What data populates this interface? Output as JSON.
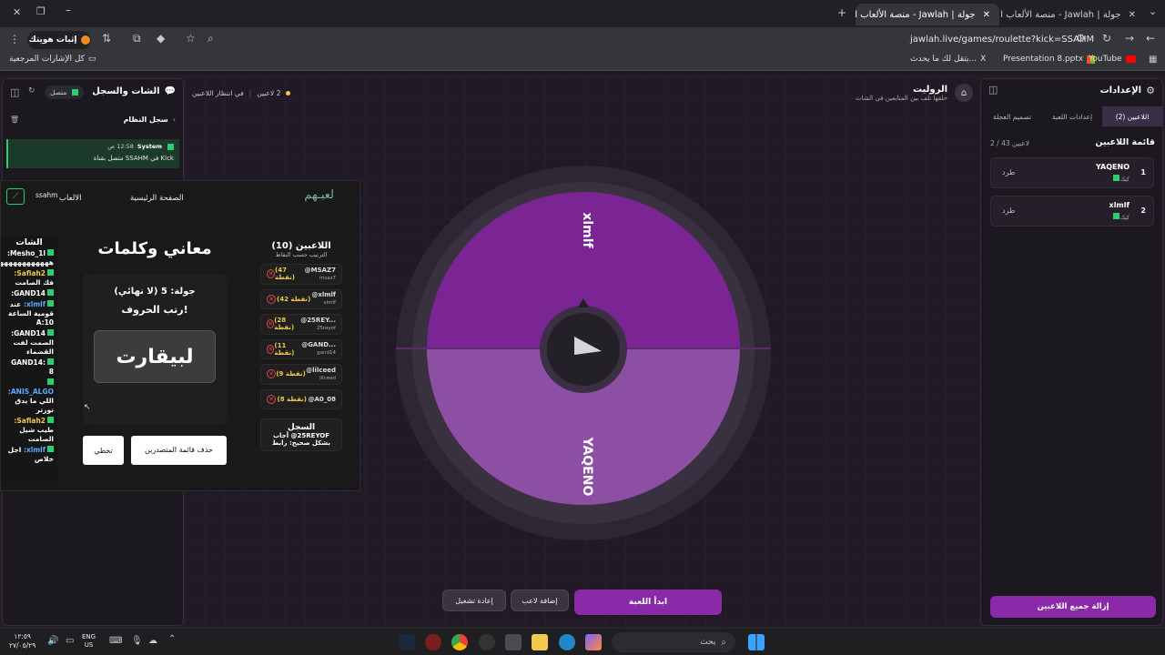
{
  "browser": {
    "tabs": [
      {
        "title": "جولة | Jawlah - منصة الألعاب التفاعلية",
        "active": true
      },
      {
        "title": "جولة | Jawlah - منصة الألعاب التفاعلية",
        "active": false
      }
    ],
    "url": "jawlah.live/games/roulette?kick=SSAHM",
    "profile_label": "إثبات هويتك",
    "bookmarks": [
      "YouTube",
      "Presentation 8.pptx",
      "يتقل لك ما يحدث...",
      "X"
    ],
    "all_bookmarks": "كل الإشارات المرجعية"
  },
  "header": {
    "title": "الروليت",
    "subtitle": "حلقها تلف بين المتابعين في الشات",
    "players_count": "2 لاعبين",
    "waiting": "في انتظار اللاعبين"
  },
  "settings": {
    "title": "الإعدادات",
    "tabs": [
      "اللاعبين (2)",
      "إعدادات اللعبة",
      "تصميم العجلة"
    ],
    "list_title": "قائمة اللاعبين",
    "list_count": "2 / 43 لاعبين",
    "players": [
      {
        "rank": "1",
        "name": "YAQENO",
        "source": "كيك",
        "kick": "طرد"
      },
      {
        "rank": "2",
        "name": "xlmlf",
        "source": "كيك",
        "kick": "طرد"
      }
    ],
    "remove_all": "إزالة جميع اللاعبين"
  },
  "chat_panel": {
    "title": "الشات والسجل",
    "status": "متصل",
    "log_title": "سجل النظام",
    "log_entry_user": "System",
    "log_entry_time": "12:58 ص",
    "log_entry_text": "متصل بقناة SSAHM في Kick"
  },
  "wheel": {
    "segments": [
      {
        "label": "xlmlf",
        "color": "#7b2494"
      },
      {
        "label": "YAQENO",
        "color": "#8d4fa3"
      }
    ]
  },
  "controls": {
    "start": "ابدأ اللعبة",
    "add_player": "إضافة لاعب",
    "replay": "إعادة تشغيل"
  },
  "overlay": {
    "logo": "لعبـهم",
    "nav_home": "الصفحة الرئيسية",
    "nav_games": "الالعاب",
    "nav_user": "ssahm",
    "players_title": "اللاعبين (10)",
    "players_sub": "الترتيب حسب النقاط",
    "players": [
      {
        "name": "@MSAZ7",
        "handle": "msaz7",
        "points": "(47 نقطة)"
      },
      {
        "name": "@xlmlf",
        "handle": "xlmlf",
        "points": "(42 نقطة)"
      },
      {
        "name": "@25REY...",
        "handle": "25reyof",
        "points": "(28 نقطة)"
      },
      {
        "name": "@GAND...",
        "handle": "gand14",
        "points": "(11 نقطة)"
      },
      {
        "name": "@lilceed",
        "handle": "lilceed",
        "points": "(9 نقطة)"
      },
      {
        "name": "@A0_08",
        "handle": "",
        "points": "(8 نقطة)"
      }
    ],
    "log_title": "السجل",
    "log_text": "25REYOF@ أجاب بشكل صحيح: رابط",
    "game_title": "معاني وكلمات",
    "round": "جولة: 5 (لا نهائي)",
    "instruction": "رتب الحروف!",
    "word": "لبيقارت",
    "btn_clear": "حذف قائمة المتصدرين",
    "btn_skip": "تخطي",
    "chat_title": "الشات",
    "chat": [
      {
        "user": "Mesho_1l:",
        "text": "هههههههههههههههههه",
        "color": "#ffffff"
      },
      {
        "user": "Safiah2:",
        "text": "فك الصامت",
        "color": "#f2c94c"
      },
      {
        "user": "GAND14:",
        "text": "",
        "color": "#ffffff"
      },
      {
        "user": "xlmlf:",
        "text": "عند قومية الساعة 10:A",
        "color": "#5aa9ff"
      },
      {
        "user": "GAND14:",
        "text": "الصمت لفت القضماء",
        "color": "#ffffff"
      },
      {
        "user": "GAND14: 8",
        "text": "",
        "color": "#ffffff"
      },
      {
        "user": "ANIS_ALGO:",
        "text": "اللي ما يدق تورتر",
        "color": "#5aa9ff"
      },
      {
        "user": "Safiah2:",
        "text": "طيب شيل الصامت",
        "color": "#f2c94c"
      },
      {
        "user": "xlmlf:",
        "text": "اجل خلاص",
        "color": "#5aa9ff"
      }
    ]
  },
  "taskbar": {
    "search": "بحث",
    "lang": "ENG",
    "region": "US",
    "time": "١٢:٥٩",
    "date": "٢٧/٠٥/٢٩"
  }
}
